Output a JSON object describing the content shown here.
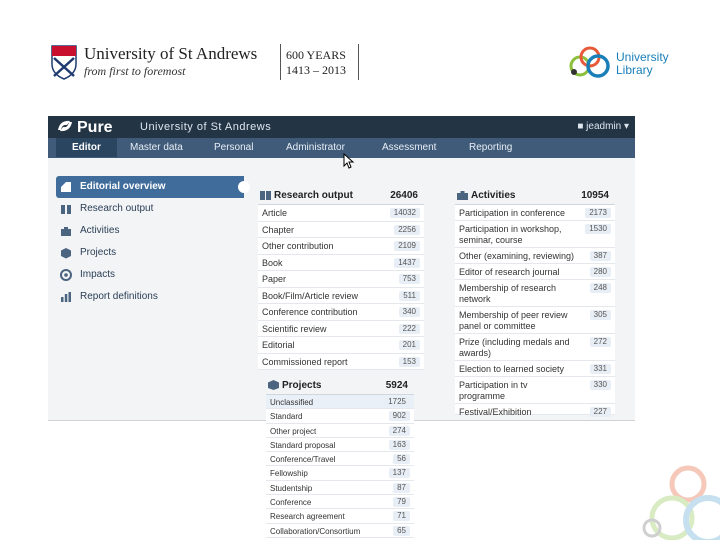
{
  "slide": {
    "university_name": "University of St Andrews",
    "tagline": "from first to foremost",
    "anniversary_line1": "600 YEARS",
    "anniversary_line2": "1413 – 2013",
    "library_line1": "University",
    "library_line2": "Library"
  },
  "app": {
    "brand": "Pure",
    "organisation": "University of St Andrews",
    "user_name": "jeadmin",
    "nav": [
      {
        "label": "Editor"
      },
      {
        "label": "Master data"
      },
      {
        "label": "Personal"
      },
      {
        "label": "Administrator"
      },
      {
        "label": "Assessment"
      },
      {
        "label": "Reporting"
      }
    ],
    "sidebar": [
      {
        "label": "Editorial overview",
        "icon": "chart-icon",
        "active": true
      },
      {
        "label": "Research output",
        "icon": "book-icon"
      },
      {
        "label": "Activities",
        "icon": "briefcase-icon"
      },
      {
        "label": "Projects",
        "icon": "box-icon"
      },
      {
        "label": "Impacts",
        "icon": "target-icon"
      },
      {
        "label": "Report definitions",
        "icon": "bar-chart-icon"
      }
    ],
    "research_output": {
      "title": "Research output",
      "total": "26406",
      "rows": [
        {
          "label": "Article",
          "value": "14032"
        },
        {
          "label": "Chapter",
          "value": "2256"
        },
        {
          "label": "Other contribution",
          "value": "2109"
        },
        {
          "label": "Book",
          "value": "1437"
        },
        {
          "label": "Paper",
          "value": "753"
        },
        {
          "label": "Book/Film/Article review",
          "value": "511"
        },
        {
          "label": "Conference contribution",
          "value": "340"
        },
        {
          "label": "Scientific review",
          "value": "222"
        },
        {
          "label": "Editorial",
          "value": "201"
        },
        {
          "label": "Commissioned report",
          "value": "153"
        }
      ]
    },
    "activities": {
      "title": "Activities",
      "total": "10954",
      "rows": [
        {
          "label": "Participation in conference",
          "value": "2173"
        },
        {
          "label": "Participation in workshop, seminar, course",
          "value": "1530"
        },
        {
          "label": "Other (examining, reviewing)",
          "value": "387"
        },
        {
          "label": "Editor of research journal",
          "value": "280"
        },
        {
          "label": "Membership of research network",
          "value": "248"
        },
        {
          "label": "Membership of peer review panel or committee",
          "value": "305"
        },
        {
          "label": "Prize (including medals and awards)",
          "value": "272"
        },
        {
          "label": "Election to learned society",
          "value": "331"
        },
        {
          "label": "Participation in tv programme",
          "value": "330"
        },
        {
          "label": "Festival/Exhibition",
          "value": "227"
        }
      ]
    },
    "projects": {
      "title": "Projects",
      "total": "5924",
      "rows": [
        {
          "label": "Unclassified",
          "value": "1725"
        },
        {
          "label": "Standard",
          "value": "902"
        },
        {
          "label": "Other project",
          "value": "274"
        },
        {
          "label": "Standard proposal",
          "value": "163"
        },
        {
          "label": "Conference/Travel",
          "value": "56"
        },
        {
          "label": "Fellowship",
          "value": "137"
        },
        {
          "label": "Studentship",
          "value": "87"
        },
        {
          "label": "Conference",
          "value": "79"
        },
        {
          "label": "Research agreement",
          "value": "71"
        },
        {
          "label": "Collaboration/Consortium",
          "value": "65"
        }
      ]
    }
  },
  "colors": {
    "topbar": "#233445",
    "nav": "#3f5b79",
    "active_sidebar": "#3f6c9b",
    "library_blue": "#1a7fb8"
  }
}
